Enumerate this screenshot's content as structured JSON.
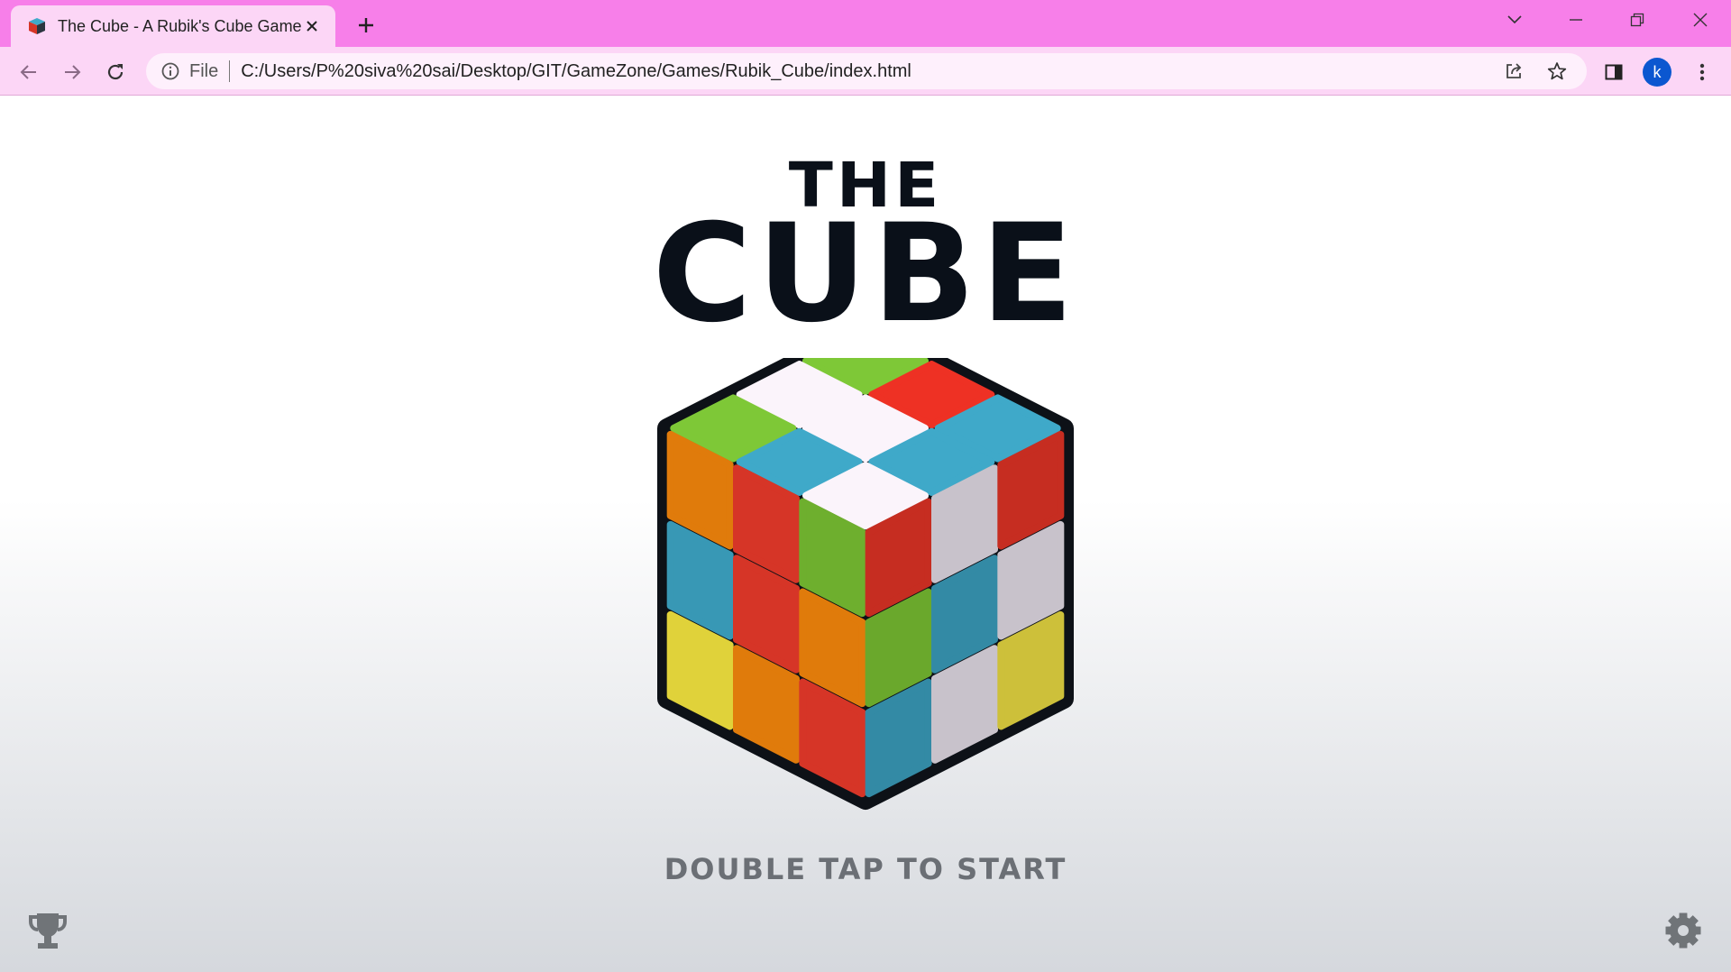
{
  "browser": {
    "tab_title": "The Cube - A Rubik's Cube Game",
    "site_label": "File",
    "url": "C:/Users/P%20siva%20sai/Desktop/GIT/GameZone/Games/Rubik_Cube/index.html",
    "profile_initial": "k",
    "colors": {
      "frame": "#f77fe9",
      "toolbar": "#fcd6f6",
      "avatar": "#0b57d0"
    }
  },
  "page": {
    "title_line1": "THE",
    "title_line2": "CUBE",
    "start_prompt": "DOUBLE TAP TO START",
    "left_icon": "trophy-icon",
    "right_icon": "gear-icon"
  },
  "cube": {
    "top": [
      [
        "#7ec837",
        "#ee3124",
        "#3fa9c9"
      ],
      [
        "#fbf4fb",
        "#fbf4fb",
        "#3fa9c9"
      ],
      [
        "#7ec837",
        "#3fa9c9",
        "#fbf4fb"
      ]
    ],
    "left": [
      [
        "#e07b0b",
        "#d63527",
        "#6eaf2e"
      ],
      [
        "#3898b5",
        "#d63527",
        "#e07b0b"
      ],
      [
        "#e0d23a",
        "#e07b0b",
        "#d63527"
      ]
    ],
    "right": [
      [
        "#c62d21",
        "#c8c2cb",
        "#c62d21"
      ],
      [
        "#6aa82c",
        "#338aa5",
        "#c8c2cb"
      ],
      [
        "#338aa5",
        "#c8c2cb",
        "#cdc03a"
      ]
    ]
  }
}
